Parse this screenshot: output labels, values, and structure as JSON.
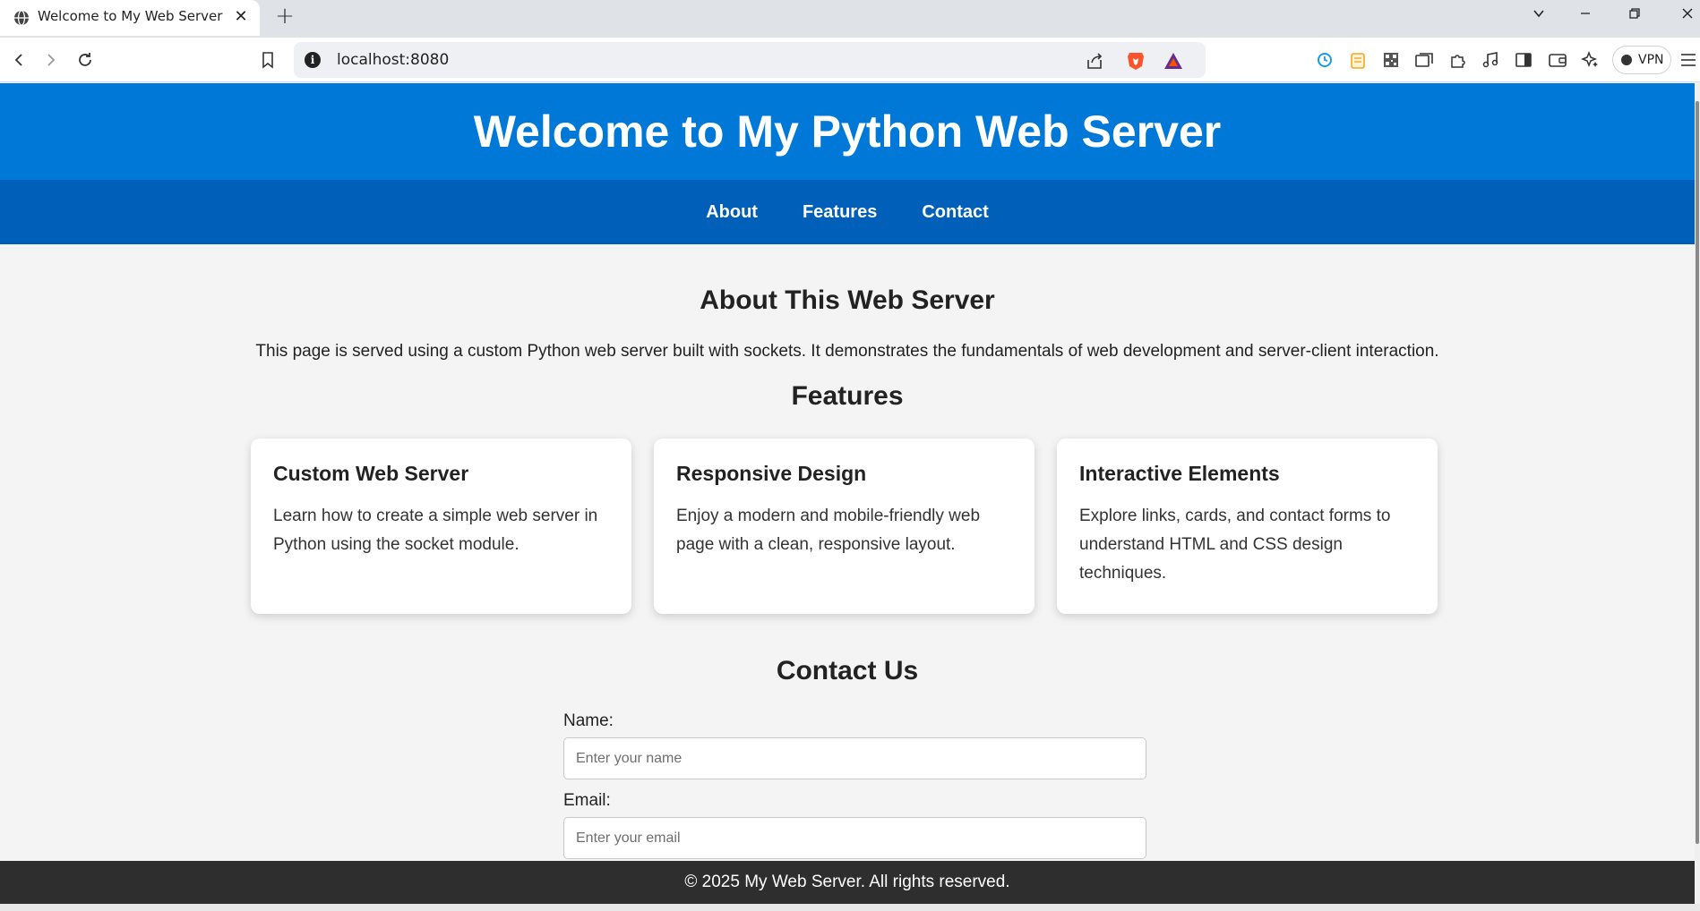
{
  "browser": {
    "tab_title": "Welcome to My Web Server",
    "new_tab_label": "+",
    "url": "localhost:8080",
    "vpn_label": "VPN"
  },
  "page": {
    "header_title": "Welcome to My Python Web Server",
    "nav": [
      "About",
      "Features",
      "Contact"
    ],
    "about": {
      "title": "About This Web Server",
      "text": "This page is served using a custom Python web server built with sockets. It demonstrates the fundamentals of web development and server-client interaction."
    },
    "features": {
      "title": "Features",
      "cards": [
        {
          "title": "Custom Web Server",
          "text": "Learn how to create a simple web server in Python using the socket module."
        },
        {
          "title": "Responsive Design",
          "text": "Enjoy a modern and mobile-friendly web page with a clean, responsive layout."
        },
        {
          "title": "Interactive Elements",
          "text": "Explore links, cards, and contact forms to understand HTML and CSS design techniques."
        }
      ]
    },
    "contact": {
      "title": "Contact Us",
      "name_label": "Name:",
      "name_placeholder": "Enter your name",
      "name_value": "",
      "email_label": "Email:",
      "email_placeholder": "Enter your email",
      "email_value": ""
    },
    "footer": "© 2025 My Web Server. All rights reserved."
  },
  "colors": {
    "header_blue": "#0078d7",
    "nav_blue": "#005fb8",
    "footer_dark": "#2e2e2e",
    "page_bg": "#f4f4f4"
  },
  "icons": [
    "globe-icon",
    "close-icon",
    "chevron-down-icon",
    "minimize-icon",
    "restore-icon",
    "window-close-icon",
    "back-icon",
    "forward-icon",
    "reload-icon",
    "bookmark-icon",
    "info-icon",
    "share-icon",
    "brave-shield-icon",
    "brave-rewards-icon",
    "timer-icon",
    "notes-icon",
    "qr-code-icon",
    "tab-group-icon",
    "extensions-icon",
    "media-icon",
    "sidebar-icon",
    "wallet-icon",
    "leo-ai-icon",
    "menu-icon"
  ]
}
